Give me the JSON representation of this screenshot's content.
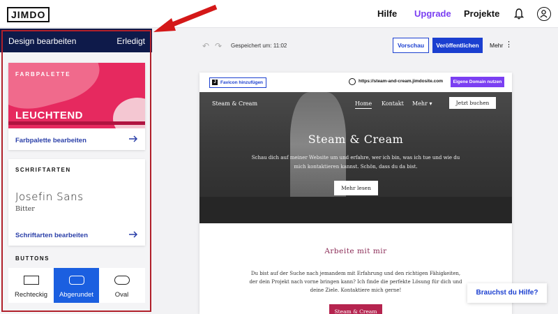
{
  "topbar": {
    "logo": "JIMDO",
    "nav": [
      "Hilfe",
      "Upgrade",
      "Projekte"
    ],
    "icons": [
      "bell-icon",
      "user-icon"
    ]
  },
  "sidebar": {
    "title": "Design bearbeiten",
    "done": "Erledigt",
    "palette": {
      "label": "FARBPALETTE",
      "name": "LEUCHTEND",
      "edit": "Farbpalette bearbeiten"
    },
    "fonts": {
      "label": "SCHRIFTARTEN",
      "primary": "Josefin Sans",
      "secondary": "Bitter",
      "edit": "Schriftarten bearbeiten"
    },
    "buttons": {
      "label": "BUTTONS",
      "options": [
        "Rechteckig",
        "Abgerundet",
        "Oval"
      ],
      "selected": "Abgerundet"
    }
  },
  "toolbar": {
    "saved": "Gespeichert um: 11:02",
    "preview": "Vorschau",
    "publish": "Veröffentlichen",
    "more": "Mehr"
  },
  "site_preview": {
    "favicon": "Favicon hinzufügen",
    "domain": "https://steam-and-cream.jimdosite.com",
    "own_domain": "Eigene Domain nutzen",
    "site_name": "Steam & Cream",
    "nav": [
      "Home",
      "Kontakt",
      "Mehr"
    ],
    "book_button": "Jetzt buchen",
    "hero_title": "Steam & Cream",
    "hero_text": "Schau dich auf meiner Website um und erfahre, wer ich bin, was ich tue und wie du mich kontaktieren kannst. Schön, dass du da bist.",
    "read_more": "Mehr lesen",
    "section_title": "Arbeite mit mir",
    "section_text": "Du bist auf der Suche nach jemandem mit Erfahrung und den richtigen Fähigkeiten, der dein Projekt nach vorne bringen kann? Ich finde die perfekte Lösung für dich und deine Ziele. Kontaktiere mich gerne!",
    "cta_button": "Steam & Cream"
  },
  "help": "Brauchst du Hilfe?",
  "colors": {
    "brand_dark": "#0e1a4a",
    "accent_blue": "#1b3fd0",
    "upgrade_purple": "#7b3ff2",
    "palette_pink": "#e6295f",
    "annotation_red": "#b0202a"
  }
}
